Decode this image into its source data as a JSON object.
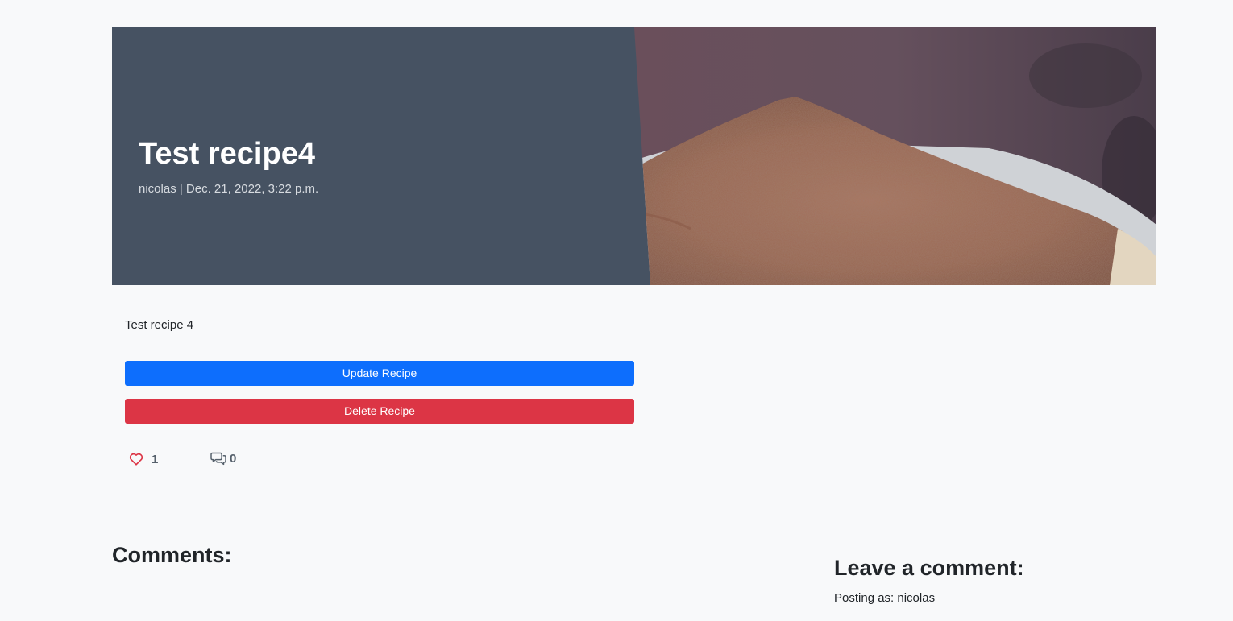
{
  "post": {
    "title": "Test recipe4",
    "meta": "nicolas | Dec. 21, 2022, 3:22 p.m.",
    "description": "Test recipe 4",
    "featured_image": "cocoa-dusted-tiramisu-photo"
  },
  "actions": {
    "update_label": "Update Recipe",
    "delete_label": "Delete Recipe"
  },
  "stats": {
    "like_icon": "heart-outline-icon",
    "like_count": "1",
    "comment_icon": "speech-bubbles-icon",
    "comment_count": "0"
  },
  "comments": {
    "heading": "Comments:",
    "form_heading": "Leave a comment:",
    "posting_as": "Posting as: nicolas"
  },
  "colors": {
    "page_bg": "#f8f9fa",
    "masthead_bg": "#465262",
    "update_btn": "#0d6efd",
    "delete_btn": "#dc3545",
    "heart": "#dc3545"
  }
}
